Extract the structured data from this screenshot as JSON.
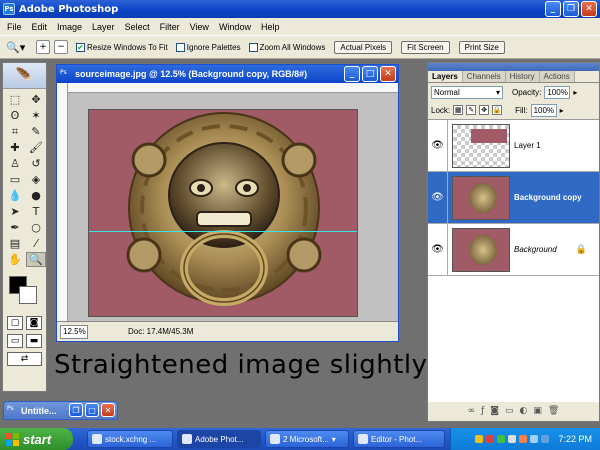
{
  "app": {
    "title": "Adobe Photoshop",
    "icon_label": "Ps"
  },
  "window_controls": {
    "minimize": "_",
    "restore": "❐",
    "close": "✕"
  },
  "menu": [
    "File",
    "Edit",
    "Image",
    "Layer",
    "Select",
    "Filter",
    "View",
    "Window",
    "Help"
  ],
  "options": {
    "tool_icon": "zoom-icon",
    "resize_windows": {
      "label": "Resize Windows To Fit",
      "checked": true
    },
    "ignore_palettes": {
      "label": "Ignore Palettes",
      "checked": false
    },
    "zoom_all": {
      "label": "Zoom All Windows",
      "checked": false
    },
    "buttons": [
      "Actual Pixels",
      "Fit Screen",
      "Print Size"
    ]
  },
  "document": {
    "title": "sourceimage.jpg @ 12.5% (Background copy, RGB/8#)",
    "zoom": "12.5%",
    "doc_info": "Doc: 17.4M/45.3M"
  },
  "caption": "Straightened image slightly",
  "minimized": {
    "title": "Untitle..."
  },
  "layers_palette": {
    "tabs": [
      "Layers",
      "Channels",
      "History",
      "Actions"
    ],
    "blend_mode": "Normal",
    "opacity_label": "Opacity:",
    "opacity": "100%",
    "lock_label": "Lock:",
    "fill_label": "Fill:",
    "fill": "100%",
    "layers": [
      {
        "name": "Layer 1",
        "visible": true,
        "selected": false,
        "locked": false
      },
      {
        "name": "Background copy",
        "visible": true,
        "selected": true,
        "locked": false
      },
      {
        "name": "Background",
        "visible": true,
        "selected": false,
        "locked": true
      }
    ]
  },
  "taskbar": {
    "start": "start",
    "tasks": [
      "stock.xchng ...",
      "Adobe Phot...",
      "2 Microsoft...",
      "Editor - Phot..."
    ],
    "clock": "7:22 PM"
  },
  "colors": {
    "accent": "#0a42c4",
    "selected_layer": "#316ac5",
    "guide": "#35e6e6",
    "image_bg": "#a05b66"
  }
}
